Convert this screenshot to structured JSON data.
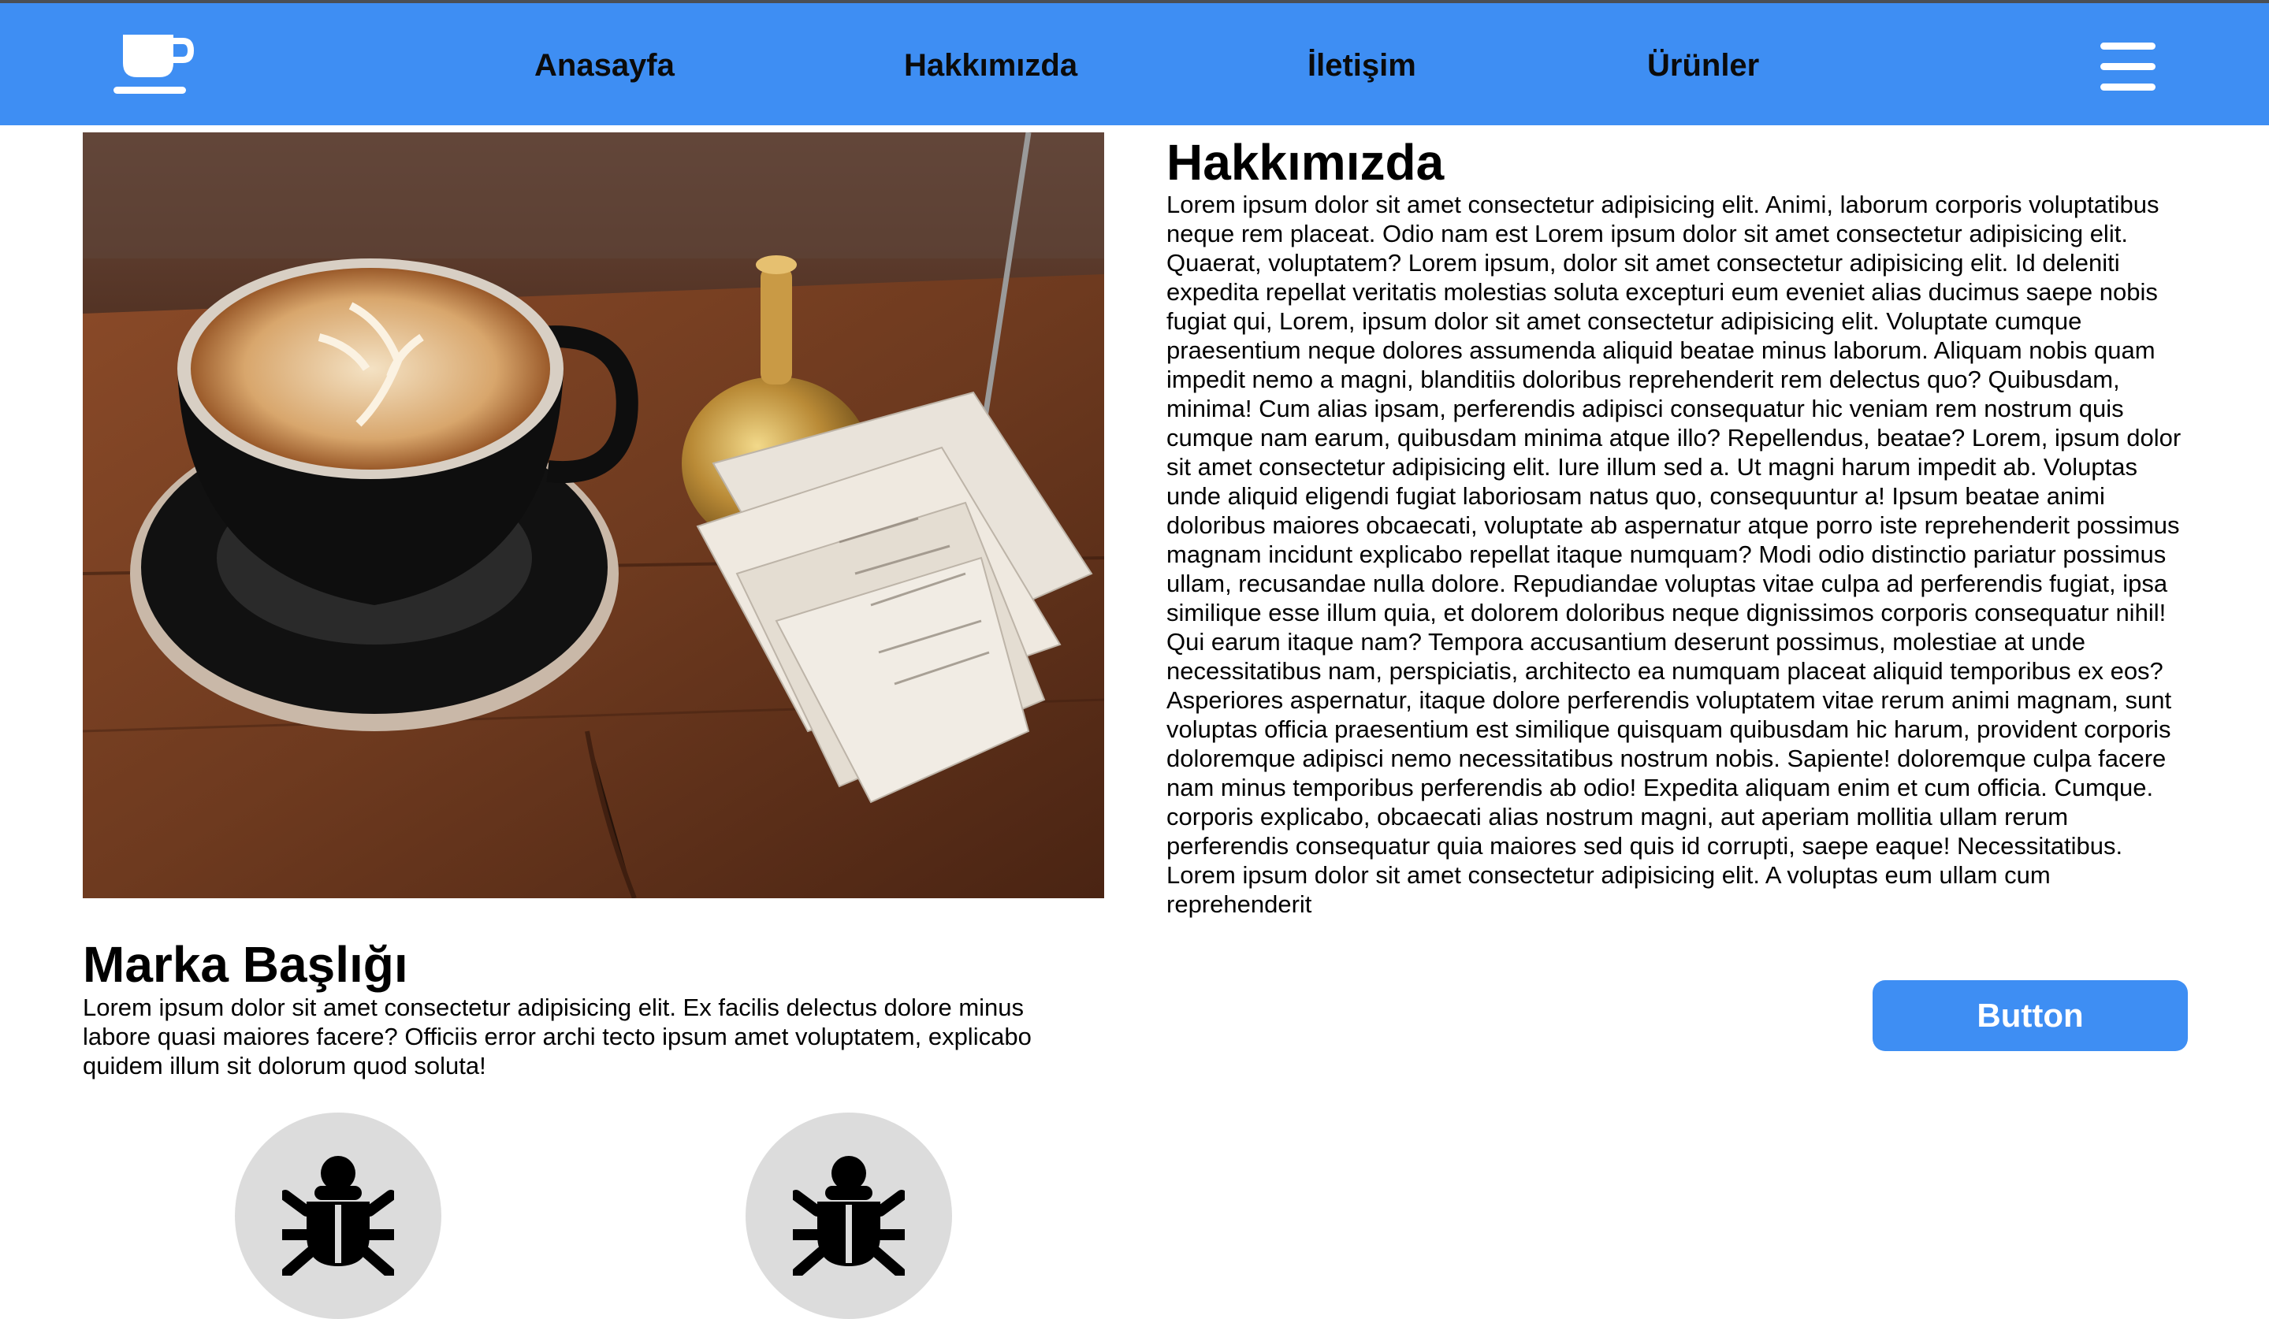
{
  "header": {
    "logo_icon": "coffee-cup-icon",
    "nav": [
      {
        "label": "Anasayfa"
      },
      {
        "label": "Hakkımızda"
      },
      {
        "label": "İletişim"
      },
      {
        "label": "Ürünler"
      }
    ],
    "menu_icon": "hamburger-menu-icon",
    "background": "#3e8ef3"
  },
  "hero": {
    "image_icon": "coffee-cup-photo"
  },
  "brand": {
    "title": "Marka Başlığı",
    "text": "Lorem ipsum dolor sit amet consectetur adipisicing elit. Ex facilis delectus dolore minus labore quasi maiores facere? Officiis error archi tecto ipsum amet voluptatem, explicabo quidem illum sit dolorum quod soluta!"
  },
  "features": [
    {
      "icon": "bug-icon"
    },
    {
      "icon": "bug-icon"
    }
  ],
  "about": {
    "title": "Hakkımızda",
    "text": "Lorem ipsum dolor sit amet consectetur adipisicing elit. Animi, laborum corporis voluptatibus neque rem placeat. Odio nam est Lorem ipsum dolor sit amet consectetur adipisicing elit. Quaerat, voluptatem? Lorem ipsum, dolor sit amet consectetur adipisicing elit. Id deleniti expedita repellat veritatis molestias soluta excepturi eum eveniet alias ducimus saepe nobis fugiat qui, Lorem, ipsum dolor sit amet consectetur adipisicing elit. Voluptate cumque praesentium neque dolores assumenda aliquid beatae minus laborum. Aliquam nobis quam impedit nemo a magni, blanditiis doloribus reprehenderit rem delectus quo? Quibusdam, minima! Cum alias ipsam, perferendis adipisci consequatur hic veniam rem nostrum quis cumque nam earum, quibusdam minima atque illo? Repellendus, beatae? Lorem, ipsum dolor sit amet consectetur adipisicing elit. Iure illum sed a. Ut magni harum impedit ab. Voluptas unde aliquid eligendi fugiat laboriosam natus quo, consequuntur a! Ipsum beatae animi doloribus maiores obcaecati, voluptate ab aspernatur atque porro iste reprehenderit possimus magnam incidunt explicabo repellat itaque numquam? Modi odio distinctio pariatur possimus ullam, recusandae nulla dolore. Repudiandae voluptas vitae culpa ad perferendis fugiat, ipsa similique esse illum quia, et dolorem doloribus neque dignissimos corporis consequatur nihil! Qui earum itaque nam? Tempora accusantium deserunt possimus, molestiae at unde necessitatibus nam, perspiciatis, architecto ea numquam placeat aliquid temporibus ex eos? Asperiores aspernatur, itaque dolore perferendis voluptatem vitae rerum animi magnam, sunt voluptas officia praesentium est similique quisquam quibusdam hic harum, provident corporis doloremque adipisci nemo necessitatibus nostrum nobis. Sapiente! doloremque culpa facere nam minus temporibus perferendis ab odio! Expedita aliquam enim et cum officia. Cumque. corporis explicabo, obcaecati alias nostrum magni, aut aperiam mollitia ullam rerum perferendis consequatur quia maiores sed quis id corrupti, saepe eaque! Necessitatibus. Lorem ipsum dolor sit amet consectetur adipisicing elit. A voluptas eum ullam cum reprehenderit",
    "button_label": "Button",
    "button_color": "#3e8ef3"
  }
}
